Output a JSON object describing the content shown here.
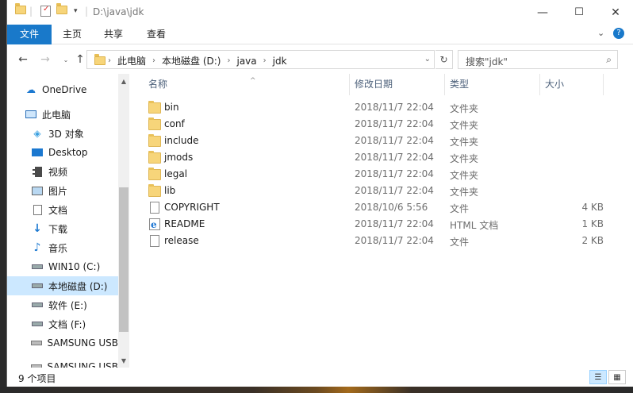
{
  "window": {
    "title": "D:\\java\\jdk",
    "controls": {
      "minimize": "—",
      "maximize": "☐",
      "close": "✕"
    }
  },
  "ribbon": {
    "tabs": [
      "文件",
      "主页",
      "共享",
      "查看"
    ],
    "collapse_icon": "chevron-down-icon",
    "help_icon": "help-icon"
  },
  "address": {
    "crumbs": [
      "此电脑",
      "本地磁盘 (D:)",
      "java",
      "jdk"
    ],
    "search_placeholder": "搜索\"jdk\""
  },
  "navpane": {
    "items": [
      {
        "label": "OneDrive",
        "icon": "cloud-icon"
      },
      {
        "label": "此电脑",
        "icon": "computer-icon"
      },
      {
        "label": "3D 对象",
        "icon": "cube-icon"
      },
      {
        "label": "Desktop",
        "icon": "desktop-icon"
      },
      {
        "label": "视频",
        "icon": "video-icon"
      },
      {
        "label": "图片",
        "icon": "picture-icon"
      },
      {
        "label": "文档",
        "icon": "document-icon"
      },
      {
        "label": "下载",
        "icon": "download-icon"
      },
      {
        "label": "音乐",
        "icon": "music-icon"
      },
      {
        "label": "WIN10 (C:)",
        "icon": "drive-icon"
      },
      {
        "label": "本地磁盘 (D:)",
        "icon": "drive-icon",
        "selected": true
      },
      {
        "label": "软件 (E:)",
        "icon": "drive-icon"
      },
      {
        "label": "文档 (F:)",
        "icon": "drive-icon"
      },
      {
        "label": "SAMSUNG USB",
        "icon": "usb-drive-icon"
      },
      {
        "label": "SAMSUNG USB",
        "icon": "usb-drive-icon"
      }
    ]
  },
  "columns": {
    "name": "名称",
    "date": "修改日期",
    "type": "类型",
    "size": "大小"
  },
  "files": [
    {
      "name": "bin",
      "date": "2018/11/7 22:04",
      "type": "文件夹",
      "size": "",
      "icon": "folder-icon"
    },
    {
      "name": "conf",
      "date": "2018/11/7 22:04",
      "type": "文件夹",
      "size": "",
      "icon": "folder-icon"
    },
    {
      "name": "include",
      "date": "2018/11/7 22:04",
      "type": "文件夹",
      "size": "",
      "icon": "folder-icon"
    },
    {
      "name": "jmods",
      "date": "2018/11/7 22:04",
      "type": "文件夹",
      "size": "",
      "icon": "folder-icon"
    },
    {
      "name": "legal",
      "date": "2018/11/7 22:04",
      "type": "文件夹",
      "size": "",
      "icon": "folder-icon"
    },
    {
      "name": "lib",
      "date": "2018/11/7 22:04",
      "type": "文件夹",
      "size": "",
      "icon": "folder-icon"
    },
    {
      "name": "COPYRIGHT",
      "date": "2018/10/6 5:56",
      "type": "文件",
      "size": "4 KB",
      "icon": "file-icon"
    },
    {
      "name": "README",
      "date": "2018/11/7 22:04",
      "type": "HTML 文档",
      "size": "1 KB",
      "icon": "html-file-icon"
    },
    {
      "name": "release",
      "date": "2018/11/7 22:04",
      "type": "文件",
      "size": "2 KB",
      "icon": "file-icon"
    }
  ],
  "status": {
    "count": "9 个项目"
  }
}
